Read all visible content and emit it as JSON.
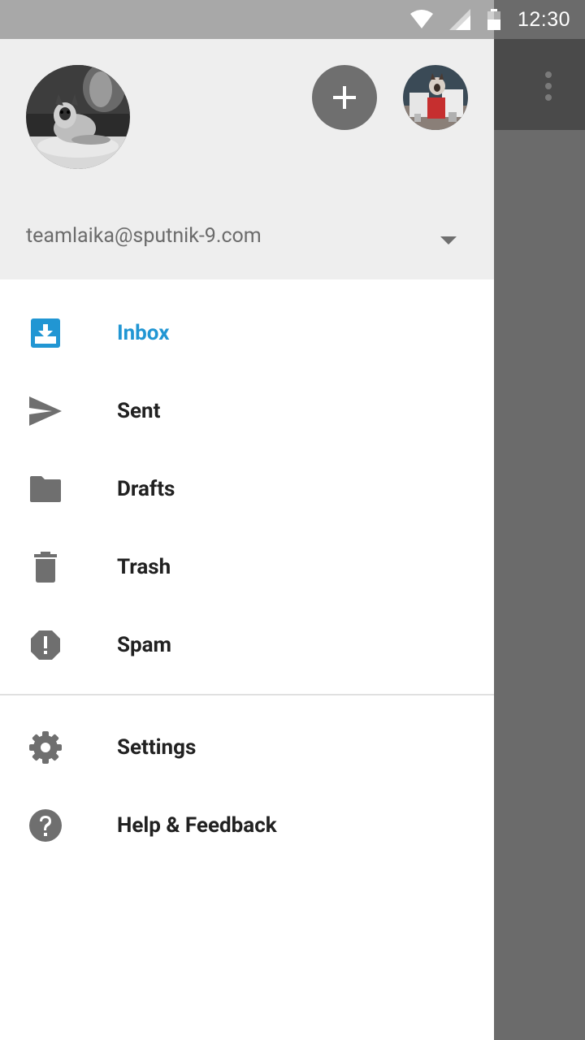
{
  "status_bar": {
    "time": "12:30",
    "icons": [
      "wifi-icon",
      "cell-signal-icon",
      "battery-icon"
    ]
  },
  "background_app": {
    "icons": [
      "overflow-menu-icon"
    ]
  },
  "drawer": {
    "header": {
      "account_email": "teamlaika@sputnik-9.com",
      "icons": [
        "add-account-icon",
        "dropdown-arrow-icon"
      ]
    },
    "nav_items": [
      {
        "label": "Inbox",
        "icon": "inbox-icon",
        "active": true
      },
      {
        "label": "Sent",
        "icon": "send-icon",
        "active": false
      },
      {
        "label": "Drafts",
        "icon": "folder-icon",
        "active": false
      },
      {
        "label": "Trash",
        "icon": "trash-icon",
        "active": false
      },
      {
        "label": "Spam",
        "icon": "spam-icon",
        "active": false
      }
    ],
    "secondary_items": [
      {
        "label": "Settings",
        "icon": "gear-icon"
      },
      {
        "label": "Help & Feedback",
        "icon": "help-icon"
      }
    ]
  },
  "colors": {
    "accent": "#2196d3",
    "icon_gray": "#6f6f6f",
    "header_bg": "#eeeeee",
    "scrim": "#6b6b6b"
  }
}
